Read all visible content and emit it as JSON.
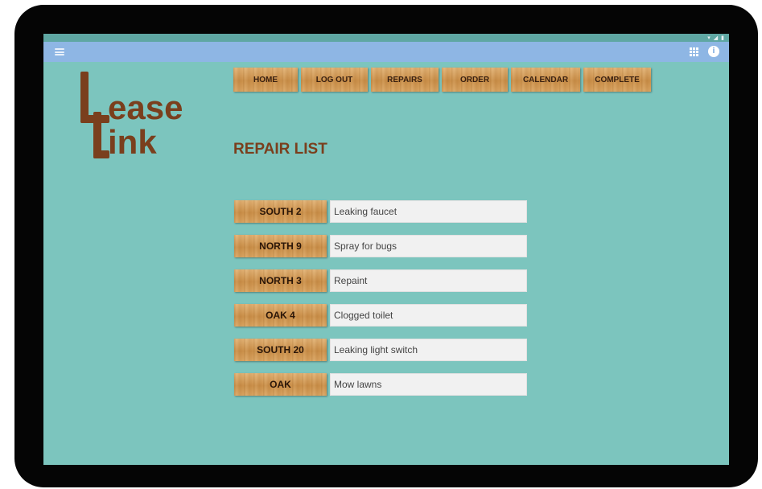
{
  "logo": {
    "text_top": "ease",
    "text_bottom": "ink"
  },
  "nav": {
    "items": [
      {
        "label": "HOME"
      },
      {
        "label": "LOG OUT"
      },
      {
        "label": "REPAIRS"
      },
      {
        "label": "ORDER"
      },
      {
        "label": "CALENDAR"
      },
      {
        "label": "COMPLETE"
      }
    ]
  },
  "page": {
    "title": "REPAIR LIST"
  },
  "repairs": [
    {
      "unit": "SOUTH 2",
      "issue": "Leaking faucet"
    },
    {
      "unit": "NORTH 9",
      "issue": "Spray for bugs"
    },
    {
      "unit": "NORTH 3",
      "issue": "Repaint"
    },
    {
      "unit": "OAK 4",
      "issue": "Clogged toilet"
    },
    {
      "unit": "SOUTH 20",
      "issue": "Leaking light switch"
    },
    {
      "unit": "OAK",
      "issue": "Mow lawns"
    }
  ],
  "icons": {
    "menu": "hamburger-menu-icon",
    "apps": "app-grid-icon",
    "info": "info-icon",
    "wifi": "wifi-icon",
    "signal": "signal-icon",
    "battery": "battery-icon"
  },
  "colors": {
    "screen_background": "#7cc5be",
    "action_bar": "#8eb6e4",
    "brand_brown": "#7a3f1d",
    "wood_button": "#d19a55"
  }
}
